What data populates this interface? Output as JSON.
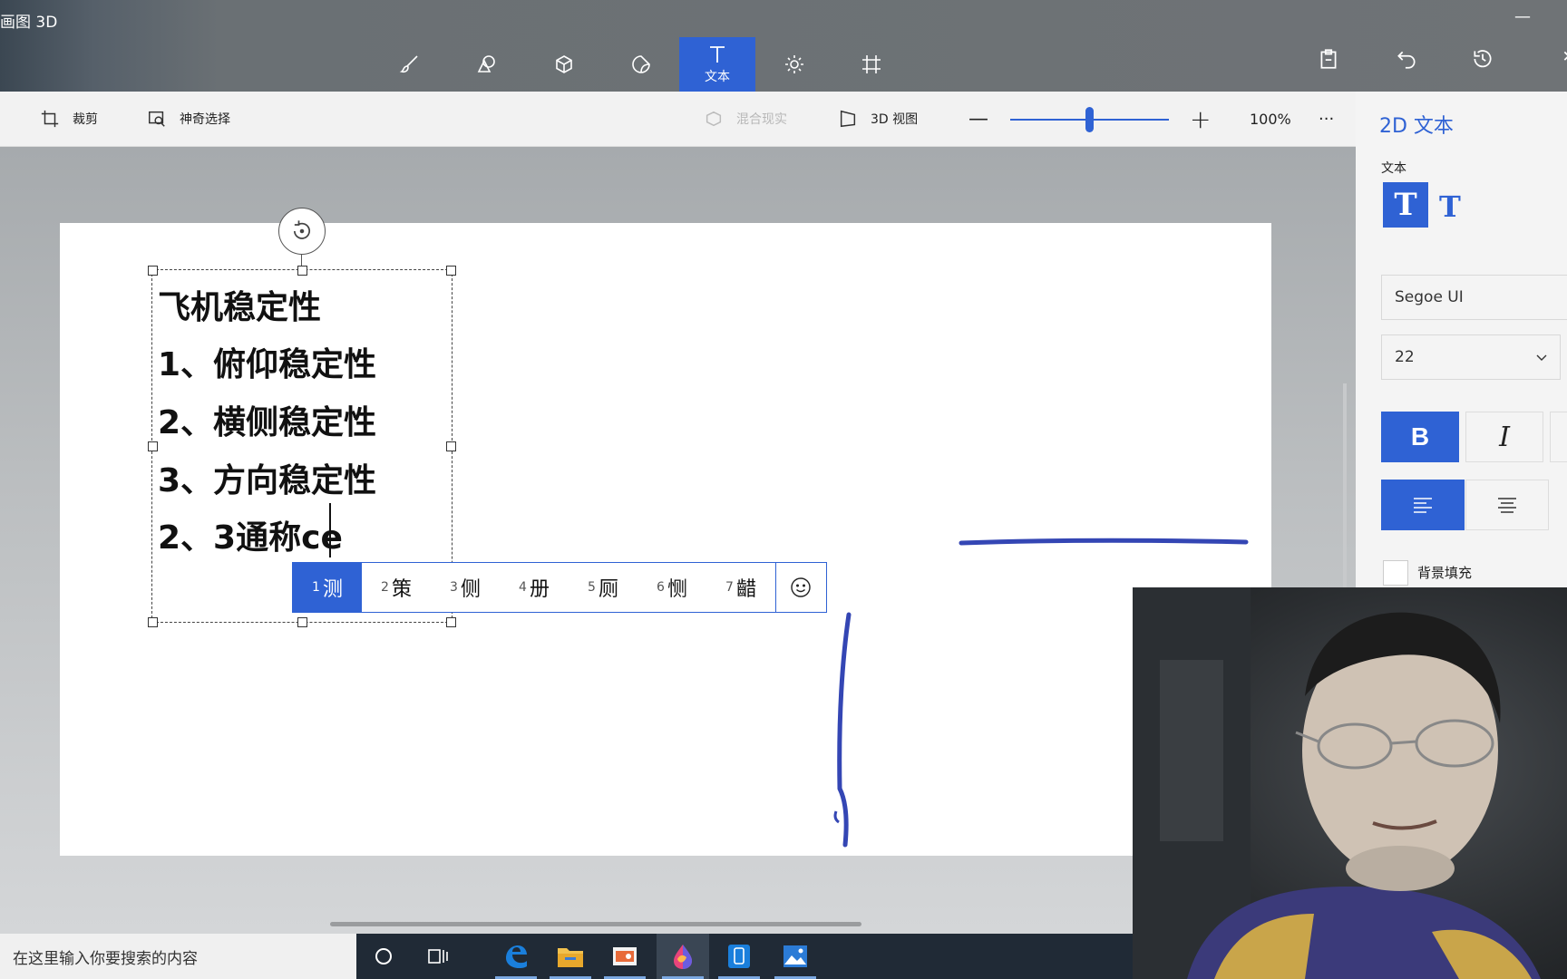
{
  "app": {
    "title": "画图 3D"
  },
  "toolbar": {
    "tools": [
      {
        "id": "brushes",
        "icon": "brush-icon"
      },
      {
        "id": "2d-shapes",
        "icon": "shapes-icon"
      },
      {
        "id": "3d-shapes",
        "icon": "cube-icon"
      },
      {
        "id": "stickers",
        "icon": "sticker-icon"
      },
      {
        "id": "text",
        "icon": "text-icon",
        "label": "文本",
        "active": true
      },
      {
        "id": "effects",
        "icon": "sun-icon"
      },
      {
        "id": "canvas",
        "icon": "canvas-icon"
      }
    ],
    "right_icons": [
      "paste-icon",
      "undo-icon",
      "history-icon",
      "redo-icon"
    ]
  },
  "subbar": {
    "crop": "裁剪",
    "magic_select": "神奇选择",
    "mixed_reality": "混合现实",
    "view_3d": "3D 视图",
    "zoom": "100%",
    "more": "···"
  },
  "canvas": {
    "lines": [
      "飞机稳定性",
      "1、俯仰稳定性",
      "2、横侧稳定性",
      "3、方向稳定性",
      "2、3通称ce"
    ]
  },
  "ime": {
    "candidates": [
      {
        "n": "1",
        "c": "测"
      },
      {
        "n": "2",
        "c": "策"
      },
      {
        "n": "3",
        "c": "侧"
      },
      {
        "n": "4",
        "c": "册"
      },
      {
        "n": "5",
        "c": "厕"
      },
      {
        "n": "6",
        "c": "恻"
      },
      {
        "n": "7",
        "c": "齰"
      }
    ]
  },
  "panel": {
    "title": "2D 文本",
    "section": "文本",
    "font": "Segoe UI",
    "size": "22",
    "bold": "B",
    "italic": "I",
    "bg_fill": "背景填充"
  },
  "taskbar": {
    "search_placeholder": "在这里输入你要搜索的内容"
  },
  "colors": {
    "accent": "#2f62d4",
    "pen": "#3446b4"
  }
}
